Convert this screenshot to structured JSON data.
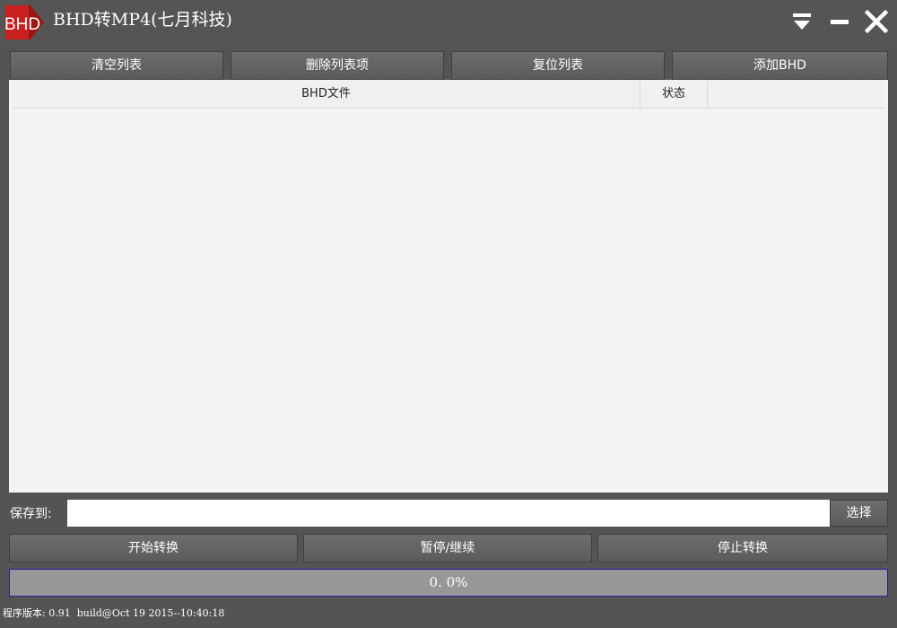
{
  "app": {
    "logo_text": "BHD",
    "title": "BHD转MP4(七月科技)"
  },
  "window_controls": {
    "tray_icon": "minimize-to-tray-icon",
    "minimize_icon": "minimize-icon",
    "close_icon": "close-icon"
  },
  "toolbar": {
    "clear_list": "清空列表",
    "delete_item": "删除列表项",
    "reset_list": "复位列表",
    "add_bhd": "添加BHD"
  },
  "file_list": {
    "columns": [
      "BHD文件",
      "状态",
      ""
    ],
    "rows": []
  },
  "output": {
    "label": "保存到:",
    "path_value": "",
    "browse_label": "选择"
  },
  "actions": {
    "start": "开始转换",
    "pause_resume": "暂停/继续",
    "stop": "停止转换"
  },
  "progress": {
    "value": 0.0,
    "text": "0. 0%"
  },
  "status_bar": {
    "version_text": "程序版本: 0.91  build@Oct 19 2015--10:40:18"
  },
  "colors": {
    "window_bg": "#545454",
    "logo_red": "#c8201e",
    "list_bg": "#f3f3f3",
    "progress_border": "#1f1fa0"
  }
}
